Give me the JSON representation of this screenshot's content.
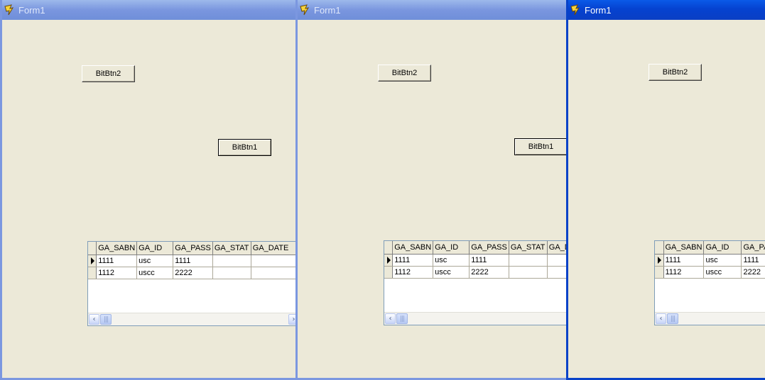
{
  "windows": [
    {
      "title": "Form1",
      "state": "inactive",
      "bitbtn2": "BitBtn2",
      "bitbtn1": "BitBtn1",
      "grid": {
        "columns": [
          "GA_SABN",
          "GA_ID",
          "GA_PASS",
          "GA_STAT",
          "GA_DATE"
        ],
        "rows": [
          [
            "1111",
            "usc",
            "1111",
            "",
            ""
          ],
          [
            "1112",
            "uscc",
            "2222",
            "",
            ""
          ]
        ]
      }
    },
    {
      "title": "Form1",
      "state": "inactive",
      "bitbtn2": "BitBtn2",
      "bitbtn1": "BitBtn1",
      "grid": {
        "columns": [
          "GA_SABN",
          "GA_ID",
          "GA_PASS",
          "GA_STAT",
          "GA_DATE"
        ],
        "rows": [
          [
            "1111",
            "usc",
            "1111",
            "",
            ""
          ],
          [
            "1112",
            "uscc",
            "2222",
            "",
            ""
          ]
        ]
      }
    },
    {
      "title": "Form1",
      "state": "active",
      "bitbtn2": "BitBtn2",
      "grid": {
        "columns": [
          "GA_SABN",
          "GA_ID",
          "GA_PASS"
        ],
        "rows": [
          [
            "1111",
            "usc",
            "1111"
          ],
          [
            "1112",
            "uscc",
            "2222"
          ]
        ]
      }
    }
  ],
  "icons": {
    "app": "delphi-app-icon",
    "scroll_left": "chevron-left-icon",
    "scroll_right": "chevron-right-icon",
    "row_pointer": "row-indicator-icon"
  },
  "colors": {
    "face": "#ece9d8",
    "active_title": "#0842c8",
    "inactive_title": "#7b97e0"
  }
}
